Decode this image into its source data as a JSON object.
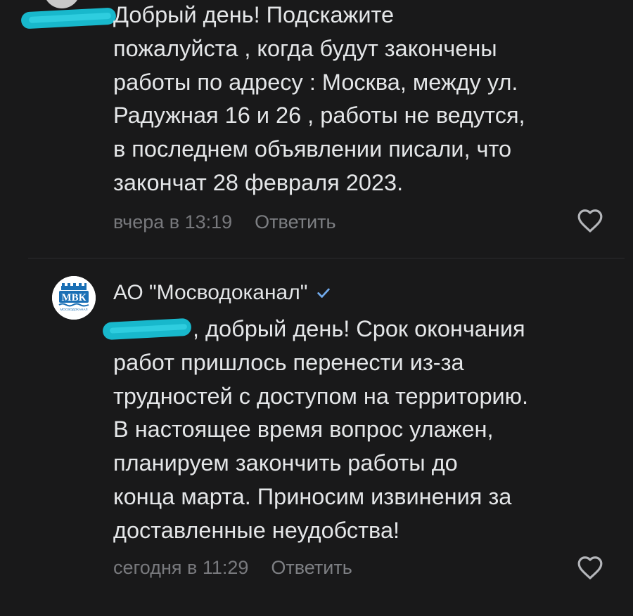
{
  "first_comment": {
    "author_avatar": "user-avatar",
    "text": "Добрый день! Подскажите\nпожалуйста , когда будут закончены\nработы по адресу : Москва, между ул.\nРадужная 16 и 26 , работы не ведутся,\nв последнем объявлении писали, что\nзакончат 28 февраля 2023.",
    "time": "вчера в 13:19",
    "reply_label": "Ответить",
    "like_icon": "heart-outline-icon"
  },
  "reply_comment": {
    "author": "АО \"Мосводоканал\"",
    "verified_icon": "checkmark-verified-icon",
    "avatar_text": "МВК",
    "avatar_subtext": "МОСВОДОКАНАЛ",
    "text": ", добрый день! Срок окончания\nработ пришлось перенести из-за\nтрудностей с доступом на территорию.\nВ настоящее время вопрос улажен,\nпланируем закончить работы до\nконца марта. Приносим извинения за\nдоставленные неудобства!",
    "time": "сегодня в 11:29",
    "reply_label": "Ответить",
    "like_icon": "heart-outline-icon"
  },
  "colors": {
    "background": "#19191a",
    "text_primary": "#e4e6e8",
    "text_secondary": "#78797d",
    "verified": "#71aaeb",
    "redaction_scribble": "#18c1d6",
    "mvk_blue": "#1a6fb5"
  }
}
